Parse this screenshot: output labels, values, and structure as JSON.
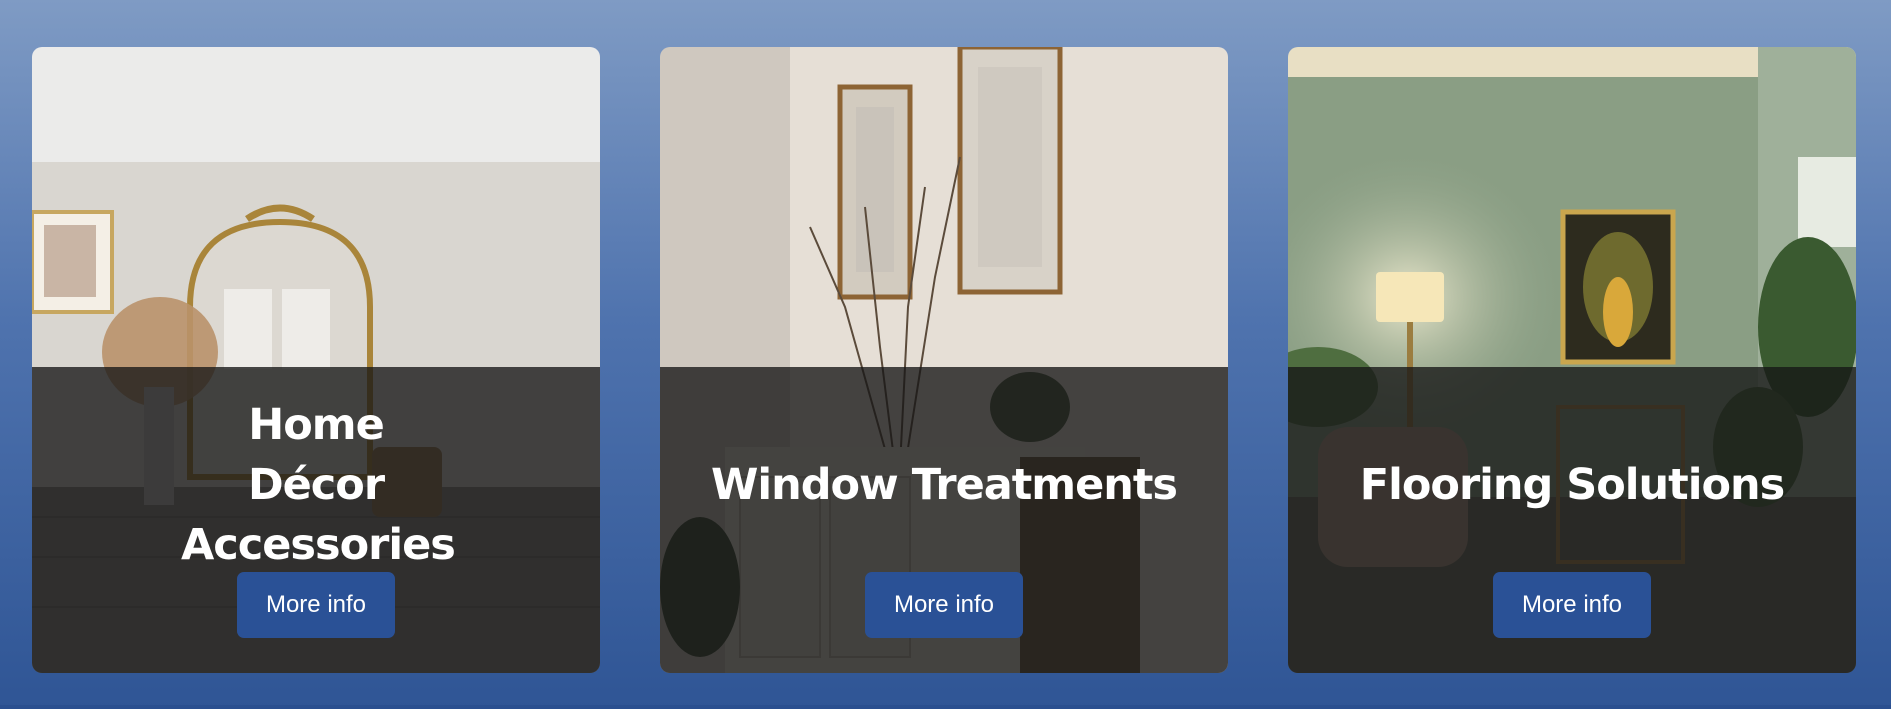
{
  "cards": [
    {
      "title": "Home Décor Accessories",
      "button_label": "More info",
      "image": "living-room-arched-mirror-pampas-grass"
    },
    {
      "title": "Window Treatments",
      "button_label": "More info",
      "image": "hallway-framed-botanical-prints-dried-branches"
    },
    {
      "title": "Flooring Solutions",
      "button_label": "More info",
      "image": "green-room-floor-lamp-framed-art"
    }
  ],
  "colors": {
    "page_gradient_top": "#7f9bc4",
    "page_gradient_bottom": "#2f5595",
    "button_bg": "#2a5196",
    "overlay": "rgba(22,22,22,0.78)"
  }
}
